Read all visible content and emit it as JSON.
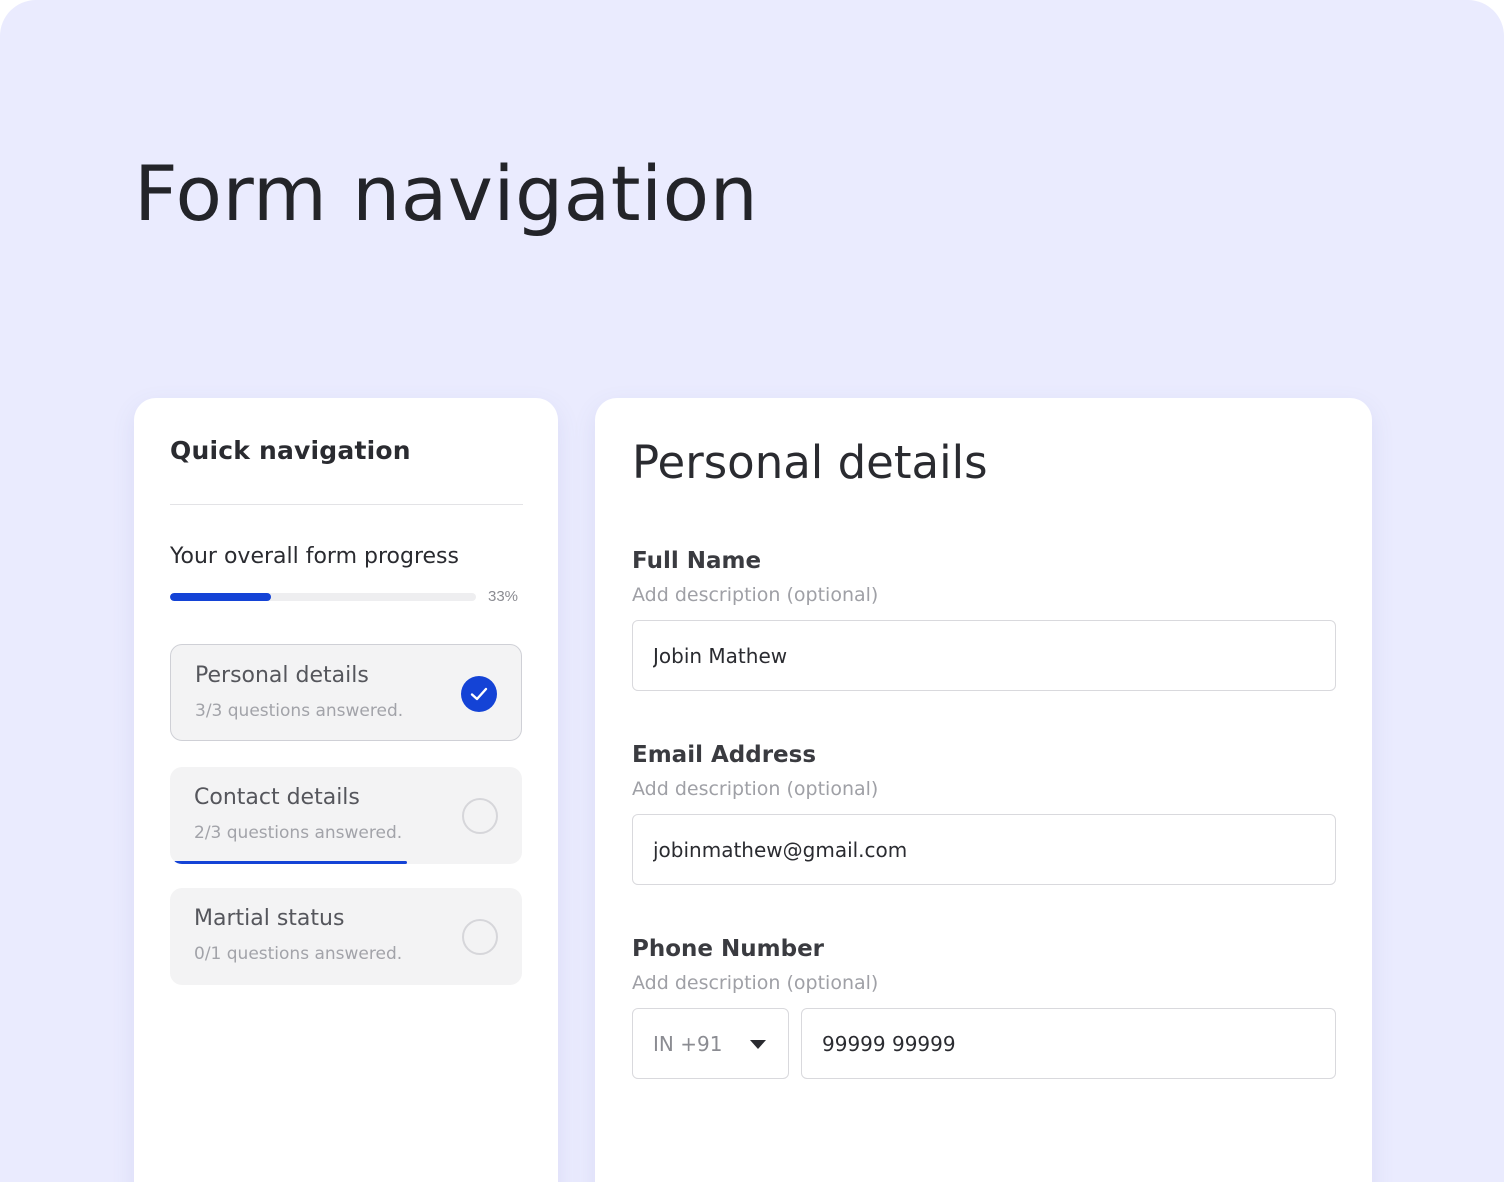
{
  "page": {
    "title": "Form navigation"
  },
  "quick_nav": {
    "title": "Quick navigation",
    "progress_label": "Your overall form progress",
    "progress_value_text": "33%",
    "progress_fraction": 0.33,
    "sections": [
      {
        "name": "Personal details",
        "count_text": "3/3 questions answered.",
        "status": "complete",
        "active": true,
        "progress_fraction": 1.0
      },
      {
        "name": "Contact details",
        "count_text": "2/3 questions answered.",
        "status": "incomplete",
        "active": false,
        "progress_fraction": 0.67
      },
      {
        "name": "Martial status",
        "count_text": "0/1 questions answered.",
        "status": "incomplete",
        "active": false,
        "progress_fraction": 0
      }
    ]
  },
  "form": {
    "title": "Personal details",
    "fields": {
      "full_name": {
        "label": "Full Name",
        "description": "Add description (optional)",
        "value": "Jobin Mathew"
      },
      "email": {
        "label": "Email Address",
        "description": "Add description (optional)",
        "value": "jobinmathew@gmail.com"
      },
      "phone": {
        "label": "Phone Number",
        "description": "Add description (optional)",
        "country_code": "IN +91",
        "value": "99999 99999"
      }
    }
  },
  "colors": {
    "background": "#eaebfe",
    "accent": "#1443d6",
    "card": "#ffffff",
    "text_primary": "#2a2b30",
    "text_muted": "#9fa0a6"
  },
  "icons": {
    "complete": "check-circle-icon",
    "incomplete": "empty-circle-icon",
    "dropdown": "caret-down-icon"
  }
}
